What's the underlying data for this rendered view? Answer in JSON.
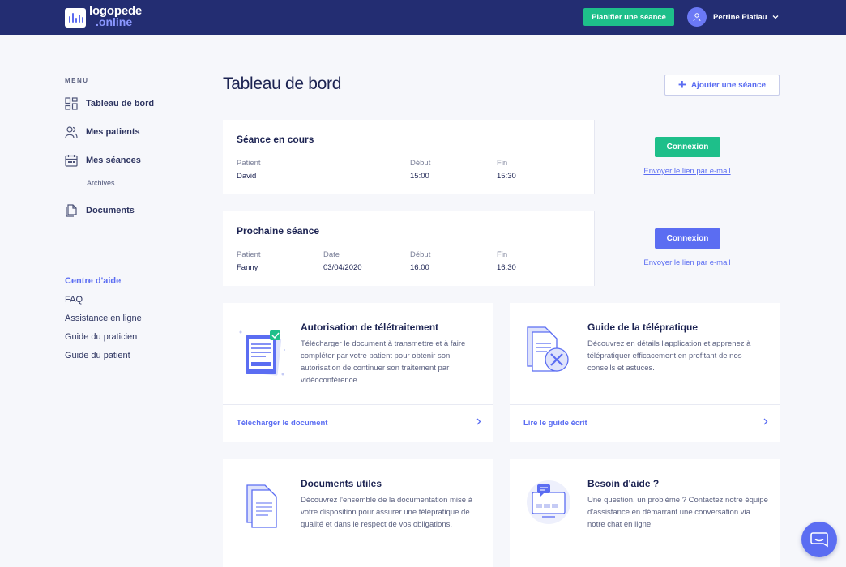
{
  "header": {
    "logo_line1": "logopede",
    "logo_line2": ".online",
    "plan_button": "Planifier une séance",
    "user_name": "Perrine Platiau"
  },
  "sidebar": {
    "menu_label": "MENU",
    "items": [
      {
        "label": "Tableau de bord",
        "icon": "dashboard-icon"
      },
      {
        "label": "Mes patients",
        "icon": "users-icon"
      },
      {
        "label": "Mes séances",
        "icon": "calendar-icon"
      },
      {
        "label": "Documents",
        "icon": "documents-icon"
      }
    ],
    "sub_item": "Archives",
    "help_title": "Centre d'aide",
    "help_links": [
      "FAQ",
      "Assistance en ligne",
      "Guide du praticien",
      "Guide du patient"
    ]
  },
  "main": {
    "title": "Tableau de bord",
    "add_button": "Ajouter une séance",
    "current_session": {
      "title": "Séance en cours",
      "columns": [
        {
          "label": "Patient",
          "value": "David"
        },
        {
          "label": "Début",
          "value": "15:00"
        },
        {
          "label": "Fin",
          "value": "15:30"
        }
      ],
      "button": "Connexion",
      "link": "Envoyer le lien par e-mail"
    },
    "next_session": {
      "title": "Prochaine séance",
      "columns": [
        {
          "label": "Patient",
          "value": "Fanny"
        },
        {
          "label": "Date",
          "value": "03/04/2020"
        },
        {
          "label": "Début",
          "value": "16:00"
        },
        {
          "label": "Fin",
          "value": "16:30"
        }
      ],
      "button": "Connexion",
      "link": "Envoyer le lien par e-mail"
    },
    "cards": [
      {
        "title": "Autorisation de télétraitement",
        "desc": "Télécharger le document à transmettre et à faire compléter par votre patient pour obtenir son autorisation de continuer son traitement par vidéoconférence.",
        "link": "Télécharger le document"
      },
      {
        "title": "Guide de la télépratique",
        "desc": "Découvrez en détails l'application et apprenez à télépratiquer efficacement en profitant de nos conseils et astuces.",
        "link": "Lire le guide écrit"
      },
      {
        "title": "Documents utiles",
        "desc": "Découvrez l'ensemble de la documentation mise à votre disposition pour assurer une télépratique de qualité et dans le respect de vos obligations."
      },
      {
        "title": "Besoin d'aide ?",
        "desc": "Une question, un problème ? Contactez notre équipe d'assistance en démarrant une conversation via notre chat en ligne."
      }
    ]
  },
  "colors": {
    "header_bg": "#232d72",
    "accent": "#5b6df2",
    "green": "#1ebf8a",
    "background": "#f6f7fb"
  }
}
